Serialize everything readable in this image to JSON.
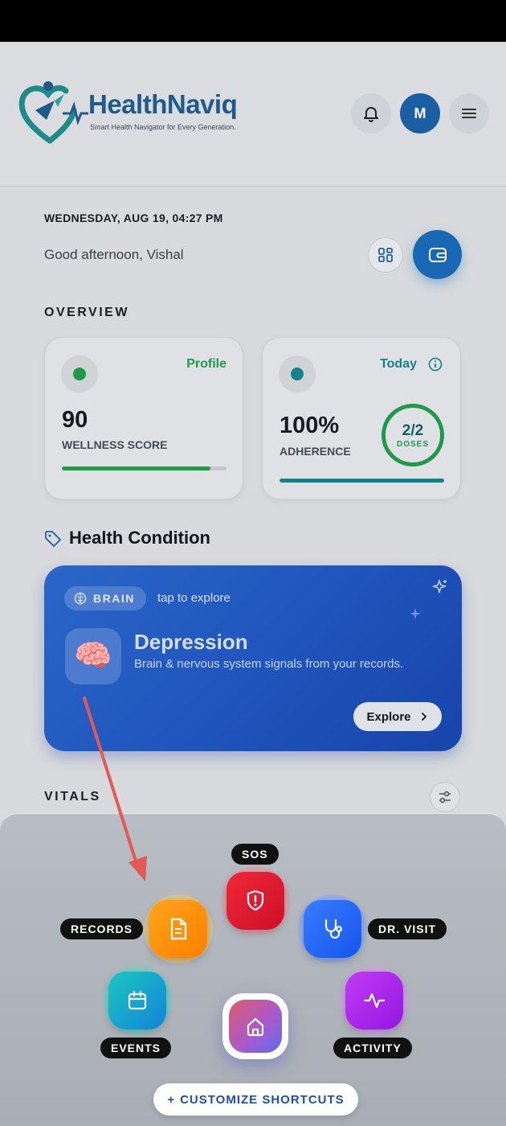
{
  "brand": {
    "name_part1": "Health",
    "name_part2": "Naviq",
    "tagline": "Smart Health Navigator for Every Generation."
  },
  "header": {
    "avatar_initial": "M"
  },
  "dashboard": {
    "datetime": "WEDNESDAY, AUG 19, 04:27 PM",
    "greeting": "Good afternoon, Vishal"
  },
  "overview": {
    "title": "OVERVIEW",
    "wellness": {
      "tag": "Profile",
      "value": "90",
      "label": "WELLNESS SCORE",
      "progress": 0.9,
      "color": "#1e9a4a"
    },
    "adherence": {
      "tag": "Today",
      "value": "100%",
      "label": "ADHERENCE",
      "doses": "2/2",
      "doses_label": "DOSES",
      "progress": 1.0,
      "color": "#15818a"
    }
  },
  "health_condition": {
    "title": "Health Condition",
    "chip": "BRAIN",
    "hint": "tap to explore",
    "condition": "Depression",
    "description": "Brain & nervous system signals from your records.",
    "button": "Explore"
  },
  "vitals": {
    "title": "VITALS"
  },
  "shortcuts": {
    "sos": "SOS",
    "records": "RECORDS",
    "dr_visit": "DR. VISIT",
    "events": "EVENTS",
    "activity": "ACTIVITY",
    "customize": "CUSTOMIZE SHORTCUTS",
    "customize_prefix": "+"
  }
}
